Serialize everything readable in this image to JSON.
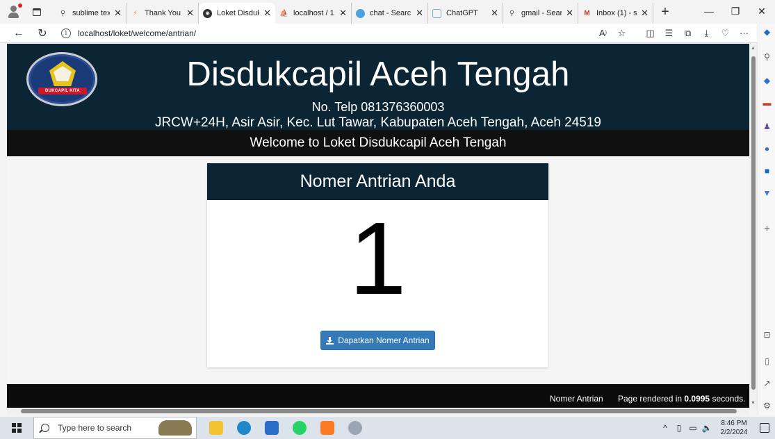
{
  "browser": {
    "tabs": [
      {
        "label": "sublime text",
        "icon": "search-icon",
        "active": false
      },
      {
        "label": "Thank You - ",
        "icon": "bolt-icon",
        "active": false
      },
      {
        "label": "Loket Disduk",
        "icon": "globe-icon",
        "active": true
      },
      {
        "label": "localhost / 1.",
        "icon": "phpmyadmin-icon",
        "active": false
      },
      {
        "label": "chat - Search",
        "icon": "copilot-icon",
        "active": false
      },
      {
        "label": "ChatGPT",
        "icon": "chatgpt-icon",
        "active": false
      },
      {
        "label": "gmail - Searc",
        "icon": "search-icon",
        "active": false
      },
      {
        "label": "Inbox (1) - sa",
        "icon": "gmail-icon",
        "active": false
      }
    ],
    "url": "localhost/loket/welcome/antrian/",
    "new_tab": "+",
    "colors": {
      "accent": "#0c2535",
      "button": "#337ab7"
    }
  },
  "header": {
    "logo_text": "DUKCAPIL KITA",
    "title": "Disdukcapil Aceh Tengah",
    "phone": "No. Telp 081376360003",
    "address": "JRCW+24H, Asir Asir, Kec. Lut Tawar, Kabupaten Aceh Tengah, Aceh 24519",
    "welcome": "Welcome to Loket Disdukcapil Aceh Tengah"
  },
  "card": {
    "title": "Nomer Antrian Anda",
    "number": "1",
    "button_label": "Dapatkan Nomer Antrian"
  },
  "footer": {
    "link": "Nomer Antrian",
    "render_prefix": "Page rendered in ",
    "render_time": "0.0995",
    "render_suffix": " seconds."
  },
  "taskbar": {
    "search_placeholder": "Type here to search",
    "time": "8:46 PM",
    "date": "2/2/2024"
  }
}
